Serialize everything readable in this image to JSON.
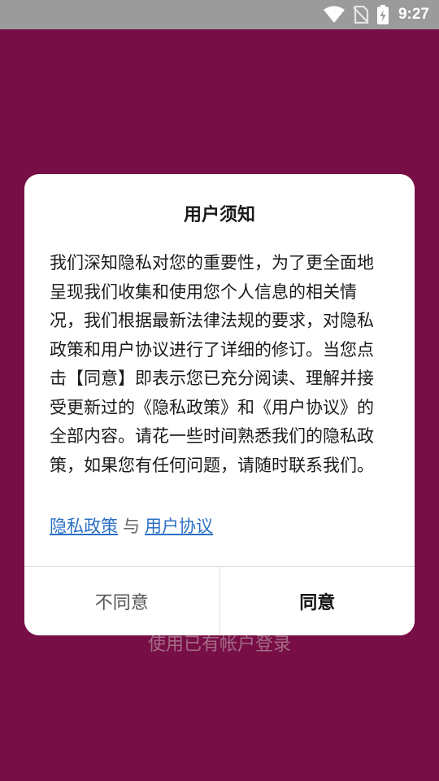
{
  "status_bar": {
    "time": "9:27",
    "icons": [
      "wifi-icon",
      "no-sim-icon",
      "battery-charging-icon"
    ]
  },
  "background": {
    "login_link": "使用已有帐户登录"
  },
  "dialog": {
    "title": "用户须知",
    "body": "我们深知隐私对您的重要性，为了更全面地呈现我们收集和使用您个人信息的相关情况，我们根据最新法律法规的要求，对隐私政策和用户协议进行了详细的修订。当您点击【同意】即表示您已充分阅读、理解并接受更新过的《隐私政策》和《用户协议》的全部内容。请花一些时间熟悉我们的隐私政策，如果您有任何问题，请随时联系我们。",
    "privacy_link": "隐私政策",
    "separator": "与",
    "terms_link": "用户协议",
    "disagree_label": "不同意",
    "agree_label": "同意"
  },
  "colors": {
    "background": "#770f46",
    "status_bar": "#9b9b9b",
    "link": "#2a6fc4"
  }
}
